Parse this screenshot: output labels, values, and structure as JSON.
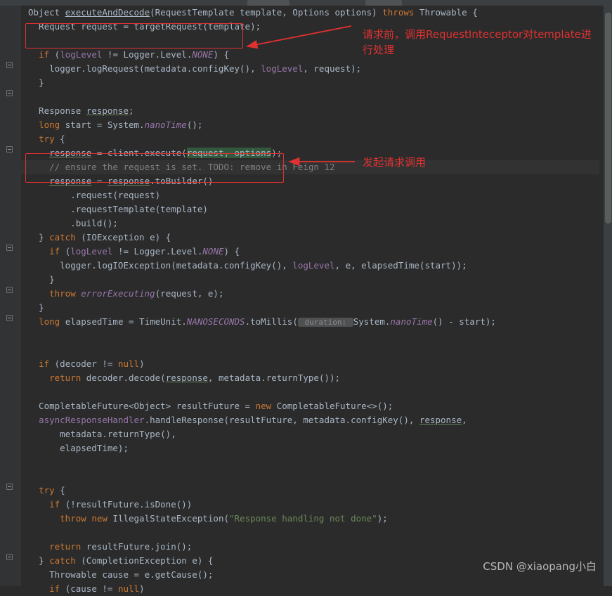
{
  "window": {
    "background": "#2b2b2b",
    "gutter_background": "#313335",
    "tab_strip_background": "#3c3f41"
  },
  "watermark": "CSDN @xiaopang小白",
  "annotations": {
    "accent_color": "#e03131",
    "items": [
      {
        "id": "anno-1",
        "text": "请求前，调用RequestInteceptor对template进行处理",
        "target_code": "Request request = targetRequest(template);"
      },
      {
        "id": "anno-2",
        "text": "发起请求调用",
        "target_code": "response = client.execute(request, options);"
      }
    ]
  },
  "editor": {
    "language": "java",
    "caret_line_index": 11,
    "lines": [
      {
        "segments": [
          {
            "t": "Object ",
            "c": "txt"
          },
          {
            "t": "executeAndDecode",
            "c": "undw"
          },
          {
            "t": "(RequestTemplate template, Options options) ",
            "c": "txt"
          },
          {
            "t": "throws",
            "c": "kw"
          },
          {
            "t": " Throwable {",
            "c": "txt"
          }
        ]
      },
      {
        "segments": [
          {
            "t": "  Request request = targetRequest(template);",
            "c": "txt"
          }
        ]
      },
      {
        "segments": [
          {
            "t": "",
            "c": "txt"
          }
        ]
      },
      {
        "segments": [
          {
            "t": "  ",
            "c": "txt"
          },
          {
            "t": "if",
            "c": "kw"
          },
          {
            "t": " (",
            "c": "txt"
          },
          {
            "t": "logLevel",
            "c": "fld"
          },
          {
            "t": " != Logger.Level.",
            "c": "txt"
          },
          {
            "t": "NONE",
            "c": "stat"
          },
          {
            "t": ") {",
            "c": "txt"
          }
        ]
      },
      {
        "segments": [
          {
            "t": "    logger.logRequest(metadata.configKey(), ",
            "c": "txt"
          },
          {
            "t": "logLevel",
            "c": "fld"
          },
          {
            "t": ", request);",
            "c": "txt"
          }
        ]
      },
      {
        "segments": [
          {
            "t": "  }",
            "c": "txt"
          }
        ]
      },
      {
        "segments": [
          {
            "t": "",
            "c": "txt"
          }
        ]
      },
      {
        "segments": [
          {
            "t": "  Response ",
            "c": "txt"
          },
          {
            "t": "response",
            "c": "und"
          },
          {
            "t": ";",
            "c": "txt"
          }
        ]
      },
      {
        "segments": [
          {
            "t": "  ",
            "c": "txt"
          },
          {
            "t": "long",
            "c": "kw"
          },
          {
            "t": " start = System.",
            "c": "txt"
          },
          {
            "t": "nanoTime",
            "c": "stat"
          },
          {
            "t": "();",
            "c": "txt"
          }
        ]
      },
      {
        "segments": [
          {
            "t": "  ",
            "c": "txt"
          },
          {
            "t": "try",
            "c": "kw"
          },
          {
            "t": " {",
            "c": "txt"
          }
        ]
      },
      {
        "segments": [
          {
            "t": "    ",
            "c": "txt"
          },
          {
            "t": "response",
            "c": "und"
          },
          {
            "t": " = client.execute(",
            "c": "txt"
          },
          {
            "t": "request, options",
            "c": "hl"
          },
          {
            "t": ");",
            "c": "txt"
          }
        ]
      },
      {
        "segments": [
          {
            "t": "    // ensure the request is set. TODO: remove in Feign 12",
            "c": "cmt"
          }
        ]
      },
      {
        "segments": [
          {
            "t": "    ",
            "c": "txt"
          },
          {
            "t": "response",
            "c": "und"
          },
          {
            "t": " = ",
            "c": "txt"
          },
          {
            "t": "response",
            "c": "und"
          },
          {
            "t": ".toBuilder()",
            "c": "txt"
          }
        ]
      },
      {
        "segments": [
          {
            "t": "        .request(request)",
            "c": "txt"
          }
        ]
      },
      {
        "segments": [
          {
            "t": "        .requestTemplate(template)",
            "c": "txt"
          }
        ]
      },
      {
        "segments": [
          {
            "t": "        .build();",
            "c": "txt"
          }
        ]
      },
      {
        "segments": [
          {
            "t": "  } ",
            "c": "txt"
          },
          {
            "t": "catch",
            "c": "kw"
          },
          {
            "t": " (IOException e) {",
            "c": "txt"
          }
        ]
      },
      {
        "segments": [
          {
            "t": "    ",
            "c": "txt"
          },
          {
            "t": "if",
            "c": "kw"
          },
          {
            "t": " (",
            "c": "txt"
          },
          {
            "t": "logLevel",
            "c": "fld"
          },
          {
            "t": " != Logger.Level.",
            "c": "txt"
          },
          {
            "t": "NONE",
            "c": "stat"
          },
          {
            "t": ") {",
            "c": "txt"
          }
        ]
      },
      {
        "segments": [
          {
            "t": "      logger.logIOException(metadata.configKey(), ",
            "c": "txt"
          },
          {
            "t": "logLevel",
            "c": "fld"
          },
          {
            "t": ", e, elapsedTime(start));",
            "c": "txt"
          }
        ]
      },
      {
        "segments": [
          {
            "t": "    }",
            "c": "txt"
          }
        ]
      },
      {
        "segments": [
          {
            "t": "    ",
            "c": "txt"
          },
          {
            "t": "throw",
            "c": "kw"
          },
          {
            "t": " ",
            "c": "txt"
          },
          {
            "t": "errorExecuting",
            "c": "stat"
          },
          {
            "t": "(request, e);",
            "c": "txt"
          }
        ]
      },
      {
        "segments": [
          {
            "t": "  }",
            "c": "txt"
          }
        ]
      },
      {
        "segments": [
          {
            "t": "  ",
            "c": "txt"
          },
          {
            "t": "long",
            "c": "kw"
          },
          {
            "t": " elapsedTime = TimeUnit.",
            "c": "txt"
          },
          {
            "t": "NANOSECONDS",
            "c": "stat"
          },
          {
            "t": ".toMillis(",
            "c": "txt"
          },
          {
            "t": " duration: ",
            "c": "hint"
          },
          {
            "t": "System.",
            "c": "txt"
          },
          {
            "t": "nanoTime",
            "c": "stat"
          },
          {
            "t": "() - start);",
            "c": "txt"
          }
        ]
      },
      {
        "segments": [
          {
            "t": "",
            "c": "txt"
          }
        ]
      },
      {
        "segments": [
          {
            "t": "",
            "c": "txt"
          }
        ]
      },
      {
        "segments": [
          {
            "t": "  ",
            "c": "txt"
          },
          {
            "t": "if",
            "c": "kw"
          },
          {
            "t": " (decoder != ",
            "c": "txt"
          },
          {
            "t": "null",
            "c": "kw"
          },
          {
            "t": ")",
            "c": "txt"
          }
        ]
      },
      {
        "segments": [
          {
            "t": "    ",
            "c": "txt"
          },
          {
            "t": "return",
            "c": "kw"
          },
          {
            "t": " decoder.decode(",
            "c": "txt"
          },
          {
            "t": "response",
            "c": "und"
          },
          {
            "t": ", metadata.returnType());",
            "c": "txt"
          }
        ]
      },
      {
        "segments": [
          {
            "t": "",
            "c": "txt"
          }
        ]
      },
      {
        "segments": [
          {
            "t": "  CompletableFuture<Object> resultFuture = ",
            "c": "txt"
          },
          {
            "t": "new",
            "c": "kw"
          },
          {
            "t": " CompletableFuture<>();",
            "c": "txt"
          }
        ]
      },
      {
        "segments": [
          {
            "t": "  ",
            "c": "txt"
          },
          {
            "t": "asyncResponseHandler",
            "c": "fld"
          },
          {
            "t": ".handleResponse(resultFuture, metadata.configKey(), ",
            "c": "txt"
          },
          {
            "t": "response",
            "c": "und"
          },
          {
            "t": ",",
            "c": "txt"
          }
        ]
      },
      {
        "segments": [
          {
            "t": "      metadata.returnType(),",
            "c": "txt"
          }
        ]
      },
      {
        "segments": [
          {
            "t": "      elapsedTime);",
            "c": "txt"
          }
        ]
      },
      {
        "segments": [
          {
            "t": "",
            "c": "txt"
          }
        ]
      },
      {
        "segments": [
          {
            "t": "",
            "c": "txt"
          }
        ]
      },
      {
        "segments": [
          {
            "t": "  ",
            "c": "txt"
          },
          {
            "t": "try",
            "c": "kw"
          },
          {
            "t": " {",
            "c": "txt"
          }
        ]
      },
      {
        "segments": [
          {
            "t": "    ",
            "c": "txt"
          },
          {
            "t": "if",
            "c": "kw"
          },
          {
            "t": " (!resultFuture.isDone())",
            "c": "txt"
          }
        ]
      },
      {
        "segments": [
          {
            "t": "      ",
            "c": "txt"
          },
          {
            "t": "throw",
            "c": "kw"
          },
          {
            "t": " ",
            "c": "txt"
          },
          {
            "t": "new",
            "c": "kw"
          },
          {
            "t": " IllegalStateException(",
            "c": "txt"
          },
          {
            "t": "\"Response handling not done\"",
            "c": "str"
          },
          {
            "t": ");",
            "c": "txt"
          }
        ]
      },
      {
        "segments": [
          {
            "t": "",
            "c": "txt"
          }
        ]
      },
      {
        "segments": [
          {
            "t": "    ",
            "c": "txt"
          },
          {
            "t": "return",
            "c": "kw"
          },
          {
            "t": " resultFuture.join();",
            "c": "txt"
          }
        ]
      },
      {
        "segments": [
          {
            "t": "  } ",
            "c": "txt"
          },
          {
            "t": "catch",
            "c": "kw"
          },
          {
            "t": " (CompletionException e) {",
            "c": "txt"
          }
        ]
      },
      {
        "segments": [
          {
            "t": "    Throwable cause = e.getCause();",
            "c": "txt"
          }
        ]
      },
      {
        "segments": [
          {
            "t": "    ",
            "c": "txt"
          },
          {
            "t": "if",
            "c": "kw"
          },
          {
            "t": " (cause != ",
            "c": "txt"
          },
          {
            "t": "null",
            "c": "kw"
          },
          {
            "t": ")",
            "c": "txt"
          }
        ]
      }
    ]
  }
}
